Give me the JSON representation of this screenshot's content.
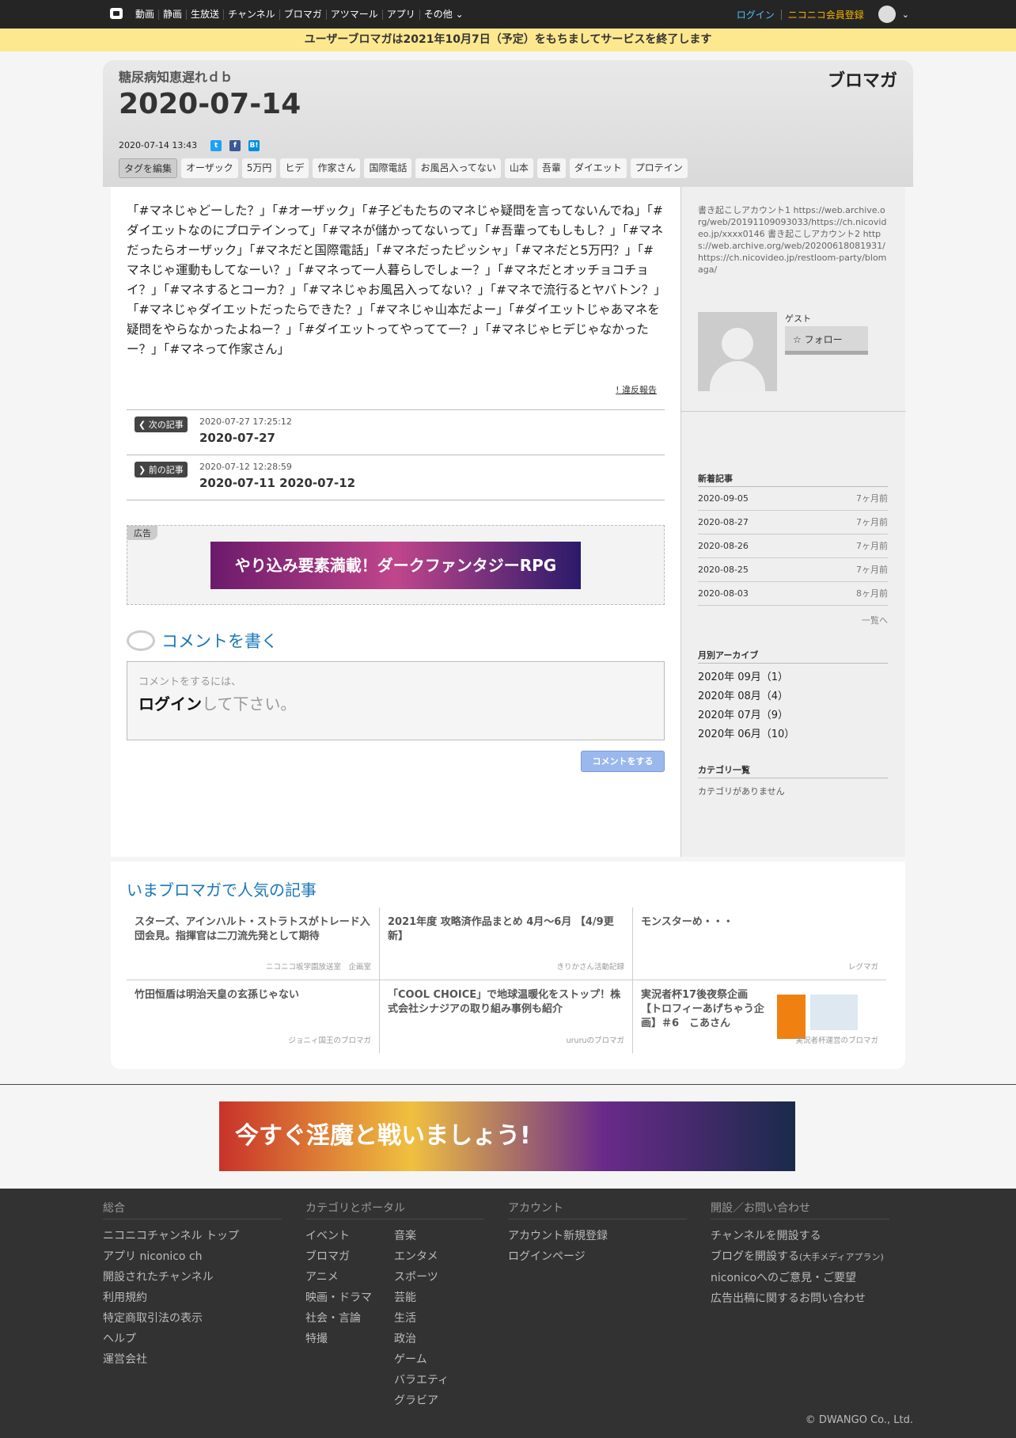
{
  "topbar": {
    "nav": [
      "動画",
      "静画",
      "生放送",
      "チャンネル",
      "ブロマガ",
      "アツマール",
      "アプリ",
      "その他"
    ],
    "login": "ログイン",
    "register": "ニコニコ会員登録"
  },
  "notice": "ユーザーブロマガは2021年10月7日（予定）をもちましてサービスを終了します",
  "header": {
    "blog_name": "糖尿病知恵遅れｄｂ",
    "title": "2020-07-14",
    "brand": "ブロマガ",
    "date": "2020-07-14 13:43",
    "tag_edit": "タグを編集",
    "tags": [
      "オーザック",
      "5万円",
      "ヒデ",
      "作家さん",
      "国際電話",
      "お風呂入ってない",
      "山本",
      "吾輩",
      "ダイエット",
      "プロテイン"
    ]
  },
  "article": {
    "body": "「#マネじゃどーした？」「#オーザック」「#子どもたちのマネじゃ疑問を言ってないんでね」「#ダイエットなのにプロテインって」「#マネが儲かってないって」「#吾輩ってもしもし？」「#マネだったらオーザック」「#マネだと国際電話」「#マネだったピッシャ」「#マネだと5万円？」「#マネじゃ運動もしてなーい？」「#マネって一人暮らしでしょー？」「#マネだとオッチョコチョイ？」「#マネするとコーカ？」「#マネじゃお風呂入ってない？」「#マネで流行るとヤバトン？」「#マネじゃダイエットだったらできた？」「#マネじゃ山本だよー」「#ダイエットじゃあマネを疑問をやらなかったよねー？」「#ダイエットってやってて一？」「#マネじゃヒデじゃなかったー？」「#マネって作家さん」",
    "report": "! 違反報告"
  },
  "next": {
    "label": "次の記事",
    "time": "2020-07-27 17:25:12",
    "title": "2020-07-27"
  },
  "prev": {
    "label": "前の記事",
    "time": "2020-07-12 12:28:59",
    "title": "2020-07-11 2020-07-12"
  },
  "ad": {
    "label": "広告",
    "banner_text": "やり込み要素満載！ダークファンタジーRPG"
  },
  "comment": {
    "heading": "コメントを書く",
    "small": "コメントをするには、",
    "login": "ログイン",
    "suffix": "して下さい。",
    "submit": "コメントをする"
  },
  "sidebar": {
    "about": "書き起こしアカウント1 https://web.archive.org/web/20191109093033/https://ch.nicovideo.jp/xxxx0146 書き起こしアカウント2 https://web.archive.org/web/20200618081931/https://ch.nicovideo.jp/restloom-party/blomaga/",
    "guest": "ゲスト",
    "follow": "フォロー",
    "recent_heading": "新着記事",
    "recent": [
      {
        "date": "2020-09-05",
        "ago": "7ヶ月前"
      },
      {
        "date": "2020-08-27",
        "ago": "7ヶ月前"
      },
      {
        "date": "2020-08-26",
        "ago": "7ヶ月前"
      },
      {
        "date": "2020-08-25",
        "ago": "7ヶ月前"
      },
      {
        "date": "2020-08-03",
        "ago": "8ヶ月前"
      }
    ],
    "more": "一覧へ",
    "archive_heading": "月別アーカイブ",
    "archive": [
      "2020年 09月（1）",
      "2020年 08月（4）",
      "2020年 07月（9）",
      "2020年 06月（10）"
    ],
    "category_heading": "カテゴリ一覧",
    "category_empty": "カテゴリがありません"
  },
  "popular": {
    "heading": "いまブロマガで人気の記事",
    "items": [
      {
        "title": "スターズ、アインハルト・ストラトスがトレード入団会見。指揮官は二刀流先発として期待",
        "source": "ニコニコ坂学園放送室　企画室"
      },
      {
        "title": "2021年度 攻略済作品まとめ 4月～6月 【4/9更新】",
        "source": "きりかさん活動記録"
      },
      {
        "title": "モンスターめ・・・",
        "source": "レグマガ"
      },
      {
        "title": "竹田恒盾は明治天皇の玄孫じゃない",
        "source": "ジョニィ国王のブロマガ"
      },
      {
        "title": "「COOL CHOICE」で地球温暖化をストップ！株式会社シナジアの取り組み事例も紹介",
        "source": "ururuのブロマガ"
      },
      {
        "title": "実況者杯17後夜祭企画【トロフィーあげちゃう企画】＃6　こあさん",
        "source": "実況者杯運営のブロマガ"
      }
    ]
  },
  "bottom_ad": "今すぐ淫魔と戦いましょう!",
  "footer": {
    "cols": [
      {
        "heading": "総合",
        "items": [
          "ニコニコチャンネル トップ",
          "アプリ niconico ch",
          "開設されたチャンネル",
          "利用規約",
          "特定商取引法の表示",
          "ヘルプ",
          "運営会社"
        ]
      },
      {
        "heading": "カテゴリとポータル",
        "items": [
          "イベント",
          "ブロマガ",
          "アニメ",
          "映画・ドラマ",
          "社会・言論",
          "特撮"
        ],
        "items2": [
          "音楽",
          "エンタメ",
          "スポーツ",
          "芸能",
          "生活",
          "政治",
          "ゲーム",
          "バラエティ",
          "グラビア"
        ]
      },
      {
        "heading": "アカウント",
        "items": [
          "アカウント新規登録",
          "ログインページ"
        ]
      },
      {
        "heading": "開設／お問い合わせ",
        "items": [
          "チャンネルを開設する",
          "ブログを開設する",
          "niconicoへのご意見・ご要望",
          "広告出稿に関するお問い合わせ"
        ],
        "blog_note": "(大手メディアプラン)"
      }
    ],
    "copyright": "© DWANGO Co., Ltd."
  }
}
